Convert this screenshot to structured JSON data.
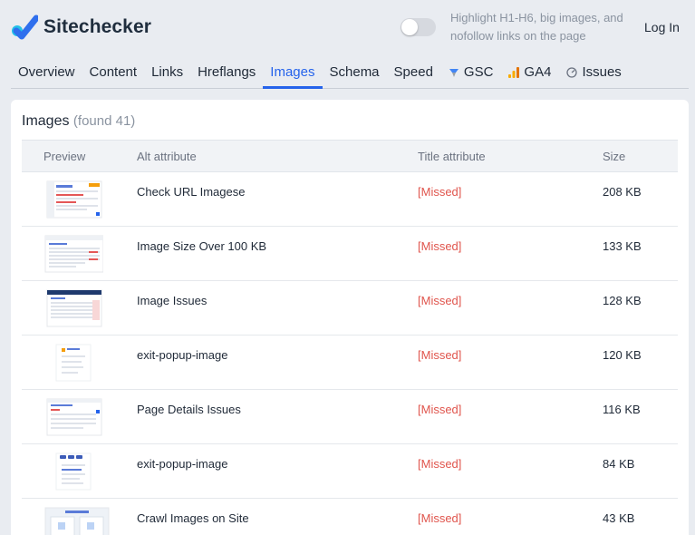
{
  "brand": {
    "name": "Sitechecker",
    "accent": "#2563eb",
    "logo_blue": "#2f6fed",
    "logo_cyan": "#22c1e8"
  },
  "toolbar": {
    "highlight_hint": "Highlight H1-H6, big images, and nofollow links on the page",
    "highlight_enabled": false,
    "login_label": "Log In"
  },
  "tabs": [
    {
      "label": "Overview",
      "icon": ""
    },
    {
      "label": "Content",
      "icon": ""
    },
    {
      "label": "Links",
      "icon": ""
    },
    {
      "label": "Hreflangs",
      "icon": ""
    },
    {
      "label": "Images",
      "icon": "",
      "active": true
    },
    {
      "label": "Schema",
      "icon": ""
    },
    {
      "label": "Speed",
      "icon": ""
    },
    {
      "label": "GSC",
      "icon": "gsc-icon"
    },
    {
      "label": "GA4",
      "icon": "ga4-icon"
    },
    {
      "label": "Issues",
      "icon": "gauge-icon"
    }
  ],
  "images_panel": {
    "title": "Images",
    "count_label": "(found 41)",
    "columns": {
      "preview": "Preview",
      "alt": "Alt attribute",
      "title": "Title attribute",
      "size": "Size"
    },
    "rows": [
      {
        "alt": "Check URL Imagese",
        "title_attr": "[Missed]",
        "size": "208 KB",
        "preview_icon": "screenshot-thumbnail-icon"
      },
      {
        "alt": "Image Size Over 100 KB",
        "title_attr": "[Missed]",
        "size": "133 KB",
        "preview_icon": "screenshot-thumbnail-icon"
      },
      {
        "alt": "Image Issues",
        "title_attr": "[Missed]",
        "size": "128 KB",
        "preview_icon": "screenshot-thumbnail-icon"
      },
      {
        "alt": "exit-popup-image",
        "title_attr": "[Missed]",
        "size": "120 KB",
        "preview_icon": "screenshot-thumbnail-icon"
      },
      {
        "alt": "Page Details Issues",
        "title_attr": "[Missed]",
        "size": "116 KB",
        "preview_icon": "screenshot-thumbnail-icon"
      },
      {
        "alt": "exit-popup-image",
        "title_attr": "[Missed]",
        "size": "84 KB",
        "preview_icon": "screenshot-thumbnail-icon"
      },
      {
        "alt": "Crawl Images on Site",
        "title_attr": "[Missed]",
        "size": "43 KB",
        "preview_icon": "screenshot-thumbnail-icon"
      }
    ]
  }
}
